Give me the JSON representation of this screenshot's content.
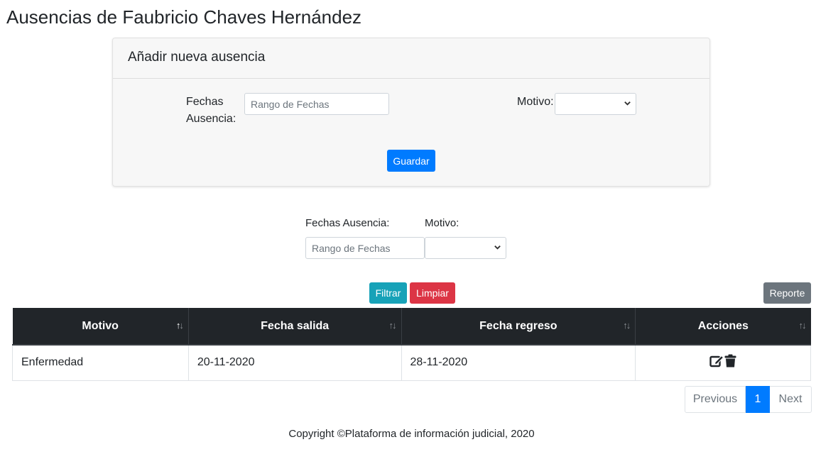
{
  "page": {
    "title": "Ausencias de Faubricio Chaves Hernández"
  },
  "add_card": {
    "header": "Añadir nueva ausencia",
    "dates_label_line1": "Fechas",
    "dates_label_line2": "Ausencia:",
    "dates_placeholder": "Rango de Fechas",
    "reason_label": "Motivo:",
    "reason_value": "",
    "save_label": "Guardar"
  },
  "filters": {
    "dates_label": "Fechas Ausencia:",
    "dates_placeholder": "Rango de Fechas",
    "reason_label": "Motivo:",
    "reason_value": "",
    "filter_label": "Filtrar",
    "clear_label": "Limpiar",
    "report_label": "Reporte"
  },
  "table": {
    "columns": [
      "Motivo",
      "Fecha salida",
      "Fecha regreso",
      "Acciones"
    ],
    "rows": [
      {
        "motivo": "Enfermedad",
        "salida": "20-11-2020",
        "regreso": "28-11-2020"
      }
    ],
    "row_actions": [
      "edit-icon",
      "trash-icon"
    ]
  },
  "pagination": {
    "prev": "Previous",
    "current": "1",
    "next": "Next"
  },
  "footer": {
    "text": "Copyright ©Plataforma de información judicial, 2020"
  },
  "colors": {
    "primary": "#007bff",
    "info": "#17a2b8",
    "danger": "#dc3545",
    "secondary": "#6c757d",
    "table_header": "#212529"
  }
}
